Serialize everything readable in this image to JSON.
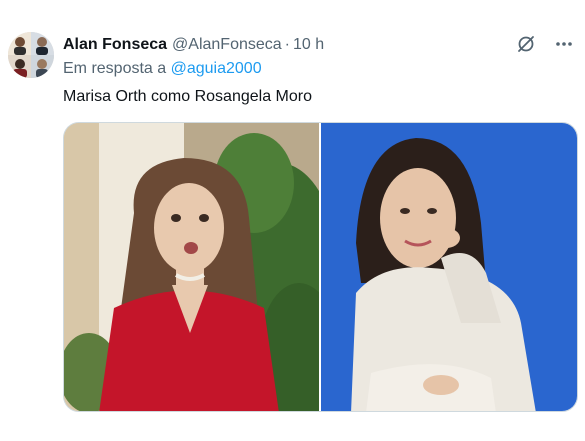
{
  "tweet": {
    "author": {
      "display_name": "Alan Fonseca",
      "handle": "@AlanFonseca",
      "separator": "·",
      "timestamp": "10 h"
    },
    "reply": {
      "prefix": "Em resposta a",
      "mention": "@aguia2000"
    },
    "text": "Marisa Orth como Rosangela Moro",
    "icons": {
      "grok": "grok-slash-icon",
      "more": "more-horizontal-icon"
    },
    "colors": {
      "text_primary": "#0f1419",
      "text_secondary": "#536471",
      "link": "#1d9bf0",
      "border": "#cfd9de",
      "right_photo_background": "#2a66cf",
      "left_photo_shirt": "#c4152a",
      "right_photo_suit": "#ece8e0"
    }
  }
}
